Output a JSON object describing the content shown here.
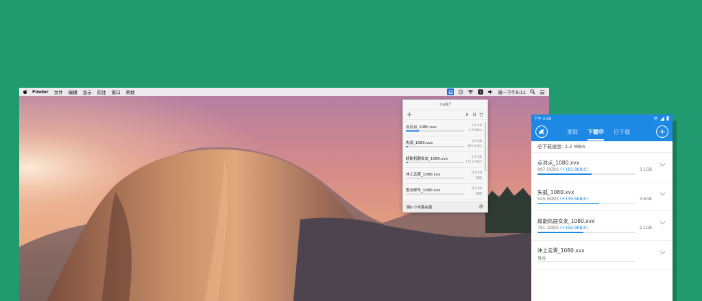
{
  "menubar": {
    "app": "Finder",
    "menus": [
      "文件",
      "编辑",
      "显示",
      "前往",
      "窗口",
      "帮助"
    ],
    "clock": "周一下午9:11"
  },
  "popover": {
    "title": "ruok?",
    "items": [
      {
        "name": "点对点_1080.xvx",
        "size": "3.1 GB",
        "speed": "1.3 MB/s",
        "progress": 0.22
      },
      {
        "name": "失孤_1080.xvx",
        "size": "3.6 GB",
        "speed": "301 K B/s",
        "progress": 0.04
      },
      {
        "name": "超能机器女友_1080.xvx",
        "size": "2.1 GB",
        "speed": "115.2 KB/s",
        "progress": 0.03
      },
      {
        "name": "冲上云霄_1080.xvx",
        "size": "0.0 KB",
        "speed": "等待",
        "progress": 0
      },
      {
        "name": "查派部车_1080.xvx",
        "size": "0.0 KB",
        "speed": "等待",
        "progress": 0
      }
    ],
    "footer": "小米路由盘"
  },
  "phone": {
    "time": "下午 2:00",
    "tabs": [
      {
        "label": "发现",
        "active": false
      },
      {
        "label": "下载中",
        "active": true
      },
      {
        "label": "已下载",
        "active": false
      }
    ],
    "total_speed": "总下载速度: 2.2 MB/s",
    "downloads": [
      {
        "name": "点对点_1080.xvx",
        "speed": "897.5KB/S",
        "increase": "(+181.8KB/S)",
        "size": "3.1GB",
        "progress": 0.55
      },
      {
        "name": "失孤_1080.xvx",
        "speed": "545.5KB/S",
        "increase": "(+139.6KB/S)",
        "size": "3.6GB",
        "progress": 0.63
      },
      {
        "name": "超能机器女友_1080.xvx",
        "speed": "791.1KB/S",
        "increase": "(+156.9KB/S)",
        "size": "2.1GB",
        "progress": 0.47
      },
      {
        "name": "冲上云霄_1080.xvx",
        "speed": "等待",
        "increase": "",
        "size": "",
        "progress": 0
      }
    ]
  },
  "colors": {
    "background": "#229a6f",
    "accent": "#1e88e5",
    "menu_selected": "#1a6fe0"
  },
  "icons": [
    "apple-icon",
    "router-icon",
    "time-machine-icon",
    "wifi-icon",
    "skype-icon",
    "volume-icon",
    "search-icon",
    "list-icon",
    "plus-icon",
    "play-icon",
    "pause-icon",
    "trash-icon",
    "folder-icon",
    "gear-icon",
    "bird-logo-icon",
    "chevron-down-icon",
    "signal-icon",
    "battery-icon"
  ]
}
